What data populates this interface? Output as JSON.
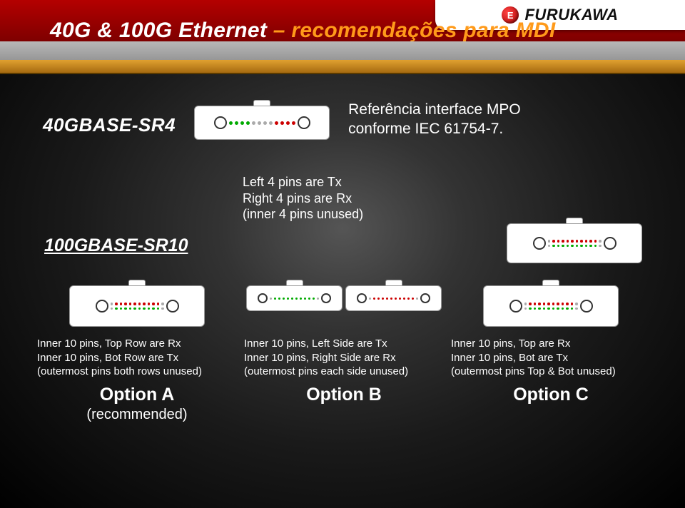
{
  "logo_text": "FURUKAWA",
  "logo_mark": "E",
  "title_part1": "40G & 100G Ethernet ",
  "title_part2": "– recomendações para MDI",
  "label_40g": "40GBASE-SR4",
  "ref_text_l1": "Referência interface MPO",
  "ref_text_l2": "conforme IEC 61754-7.",
  "pin_note_l1": "Left 4 pins are Tx",
  "pin_note_l2": "Right 4 pins are Rx",
  "pin_note_l3": "(inner 4 pins unused)",
  "label_100g": "100GBASE-SR10",
  "options": [
    {
      "desc_l1": "Inner 10 pins, Top Row are Rx",
      "desc_l2": "Inner 10 pins, Bot Row are Tx",
      "desc_l3": "(outermost pins both rows unused)",
      "title": "Option A",
      "sub": "(recommended)"
    },
    {
      "desc_l1": "Inner 10 pins, Left Side are Tx",
      "desc_l2": "Inner 10 pins, Right Side are Rx",
      "desc_l3": "(outermost pins each side unused)",
      "title": "Option B",
      "sub": ""
    },
    {
      "desc_l1": "Inner 10 pins, Top are Rx",
      "desc_l2": "Inner 10 pins, Bot are Tx",
      "desc_l3": "(outermost pins Top & Bot unused)",
      "title": "Option C",
      "sub": ""
    }
  ]
}
